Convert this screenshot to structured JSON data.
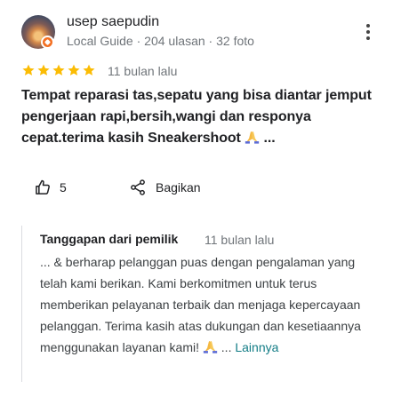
{
  "reviewer": {
    "name": "usep saepudin",
    "meta": "Local Guide · 204 ulasan · 32 foto"
  },
  "rating": {
    "stars": 5,
    "max": 5,
    "star_color": "#fbbc04"
  },
  "review": {
    "time": "11 bulan lalu",
    "text_before_emoji": "Tempat reparasi tas,sepatu yang bisa diantar jemput pengerjaan rapi,bersih,wangi dan responya cepat.terima kasih Sneakershoot",
    "text_after_emoji": " ..."
  },
  "actions": {
    "like_count": "5",
    "share_label": "Bagikan"
  },
  "owner_response": {
    "title": "Tanggapan dari pemilik",
    "time": "11 bulan lalu",
    "text_before_emoji": "... & berharap pelanggan puas dengan pengalaman yang telah kami berikan. Kami berkomitmen untuk terus memberikan pelayanan terbaik dan menjaga kepercayaan pelanggan. Terima kasih atas dukungan dan kesetiaannya menggunakan layanan kami!",
    "text_after_emoji": " ... ",
    "more_label": "Lainnya"
  },
  "icons": {
    "more": "more-vert-icon",
    "like": "thumb-up-icon",
    "share": "share-icon",
    "emoji": "folded-hands-emoji"
  },
  "colors": {
    "link": "#137d86",
    "meta_text": "#70757a",
    "badge": "#f36f21"
  }
}
